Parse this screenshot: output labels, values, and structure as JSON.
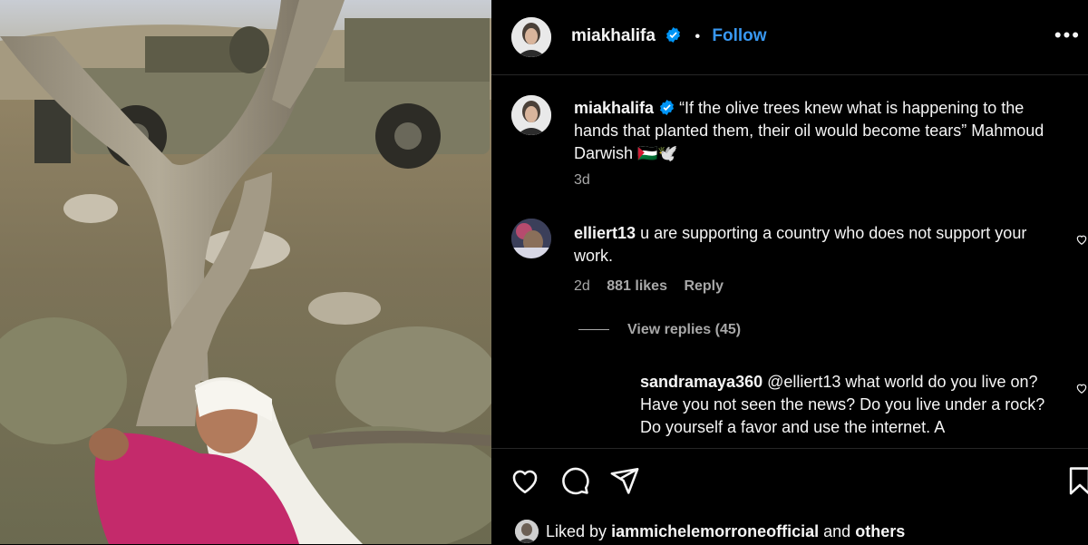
{
  "post": {
    "username": "miakhalifa",
    "follow_label": "Follow",
    "separator": "•",
    "more_label": "•••"
  },
  "caption": {
    "username": "miakhalifa",
    "text": "“If the olive trees knew what is happening to the hands that planted them, their oil would become tears” Mahmoud Darwish 🇵🇸🕊️",
    "time": "3d"
  },
  "comments": [
    {
      "username": "elliert13",
      "text": "u are supporting a country who does not support your work.",
      "time": "2d",
      "likes": "881 likes",
      "reply_label": "Reply",
      "view_replies": "View replies (45)"
    },
    {
      "username": "sandramaya360",
      "text": "@elliert13 what world do you live on? Have you not seen the news? Do you live under a rock? Do yourself a favor and use the internet. A"
    }
  ],
  "liked_by": {
    "prefix": "Liked by",
    "user": "iammichelemorroneofficial",
    "and": "and",
    "others": "others"
  },
  "icons": {
    "like": "heart-icon",
    "comment": "comment-bubble-icon",
    "share": "paper-plane-icon",
    "save": "bookmark-icon",
    "verified": "verified-badge-icon",
    "more": "more-horizontal-icon"
  },
  "colors": {
    "background": "#000000",
    "follow": "#3897f0",
    "secondary_text": "#a8a8a8",
    "verified": "#0095f6"
  }
}
